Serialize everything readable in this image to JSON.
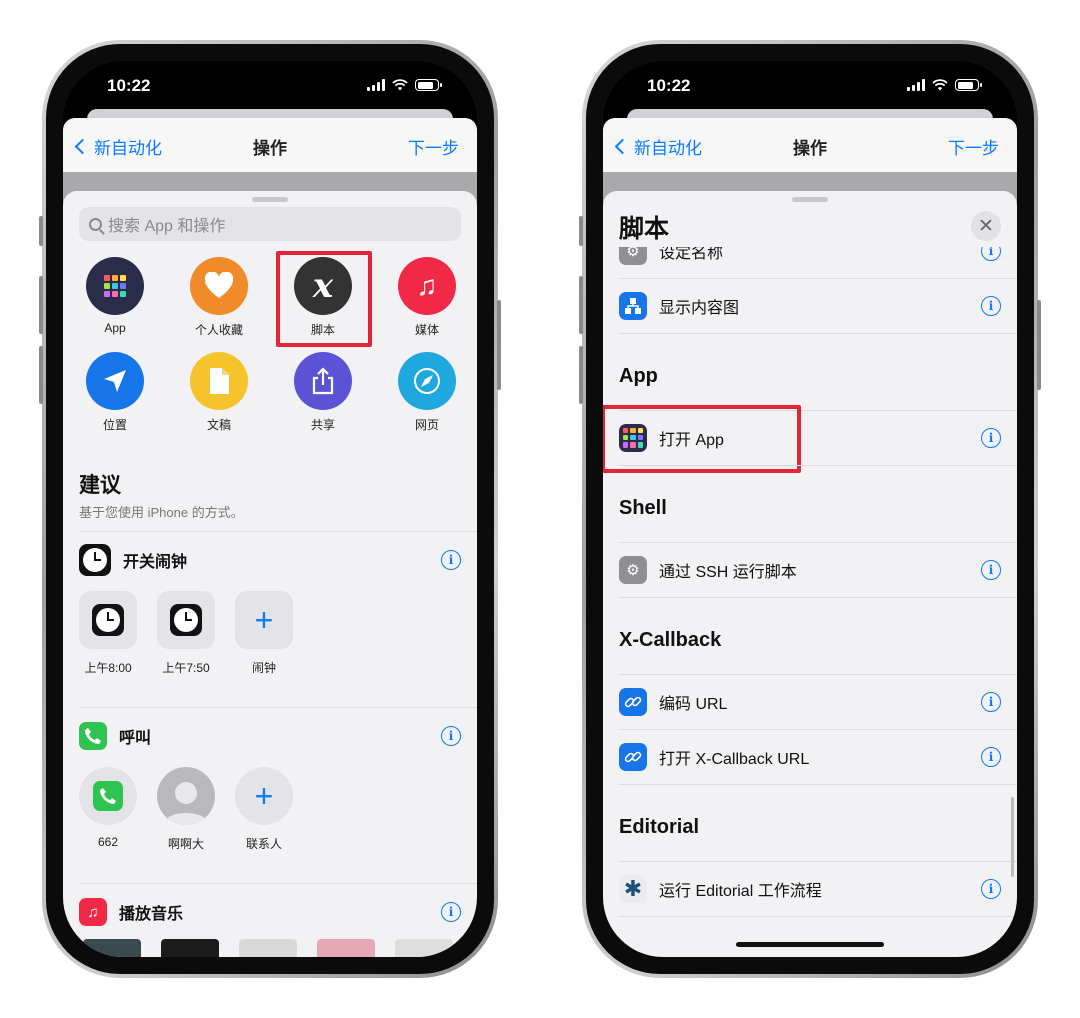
{
  "status": {
    "time": "10:22"
  },
  "left": {
    "nav": {
      "back": "新自动化",
      "title": "操作",
      "next": "下一步"
    },
    "search": {
      "placeholder": "搜索 App 和操作"
    },
    "categories": [
      {
        "label": "App",
        "icon": "app-grid-icon",
        "color": "#2b2c4a"
      },
      {
        "label": "个人收藏",
        "icon": "heart-icon",
        "color": "#f08a2a"
      },
      {
        "label": "脚本",
        "icon": "variable-x-icon",
        "color": "#333333"
      },
      {
        "label": "媒体",
        "icon": "music-note-icon",
        "color": "#f02a46"
      },
      {
        "label": "位置",
        "icon": "location-arrow-icon",
        "color": "#1675e8"
      },
      {
        "label": "文稿",
        "icon": "document-icon",
        "color": "#f5c32c"
      },
      {
        "label": "共享",
        "icon": "share-icon",
        "color": "#5b52d6"
      },
      {
        "label": "网页",
        "icon": "compass-icon",
        "color": "#1fa8e0"
      }
    ],
    "suggestions": {
      "title": "建议",
      "subtitle": "基于您使用 iPhone 的方式。",
      "alarm": {
        "title": "开关闹钟",
        "tiles": [
          "上午8:00",
          "上午7:50",
          "闹钟"
        ]
      },
      "call": {
        "title": "呼叫",
        "tiles": [
          "662",
          "啊啊大",
          "联系人"
        ]
      },
      "music": {
        "title": "播放音乐"
      }
    }
  },
  "right": {
    "nav": {
      "back": "新自动化",
      "title": "操作",
      "next": "下一步"
    },
    "sheet_title": "脚本",
    "items": {
      "set_name": "设定名称",
      "show_graph": "显示内容图",
      "app_group": "App",
      "open_app": "打开 App",
      "shell_group": "Shell",
      "ssh": "通过 SSH 运行脚本",
      "xcb_group": "X-Callback",
      "encode_url": "编码 URL",
      "open_xcb": "打开 X-Callback URL",
      "editorial_group": "Editorial",
      "run_editorial": "运行 Editorial 工作流程"
    }
  },
  "colors": {
    "accent": "#0a7aff",
    "highlight": "#e2263a"
  }
}
